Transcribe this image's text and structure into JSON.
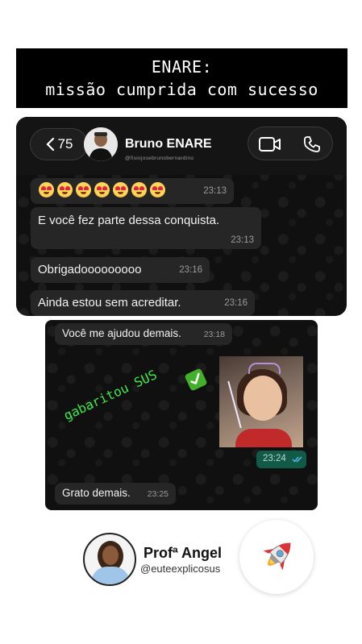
{
  "title": {
    "line1": "ENARE:",
    "line2": "missão cumprida com sucesso"
  },
  "chat1": {
    "back_count": "75",
    "contact_name": "Bruno ENARE",
    "contact_handle": "@fisiojosebrunobernardino",
    "messages": [
      {
        "kind": "emoji",
        "icon": "heart-eyes-emoji-x7",
        "time": "23:13"
      },
      {
        "text": "E você fez parte dessa conquista.",
        "time": "23:13"
      },
      {
        "text": "Obrigadooooooooo",
        "time": "23:16"
      },
      {
        "text": "Ainda estou sem acreditar.",
        "time": "23:16"
      }
    ]
  },
  "chat2": {
    "messages": [
      {
        "text": "Você me ajudou demais.",
        "time": "23:18"
      },
      {
        "text": "Grato demais.",
        "time": "23:25"
      }
    ],
    "sent_photo_time": "23:24",
    "overlay_text": "gabaritou SUS"
  },
  "profile": {
    "name": "Profª Angel",
    "handle": "@euteexplicosus",
    "action_icon": "rocket-icon"
  },
  "colors": {
    "chat_bg": "#101010",
    "bubble": "#262626",
    "sent_bubble": "#125a48",
    "overlay_green": "#3ee64c"
  }
}
